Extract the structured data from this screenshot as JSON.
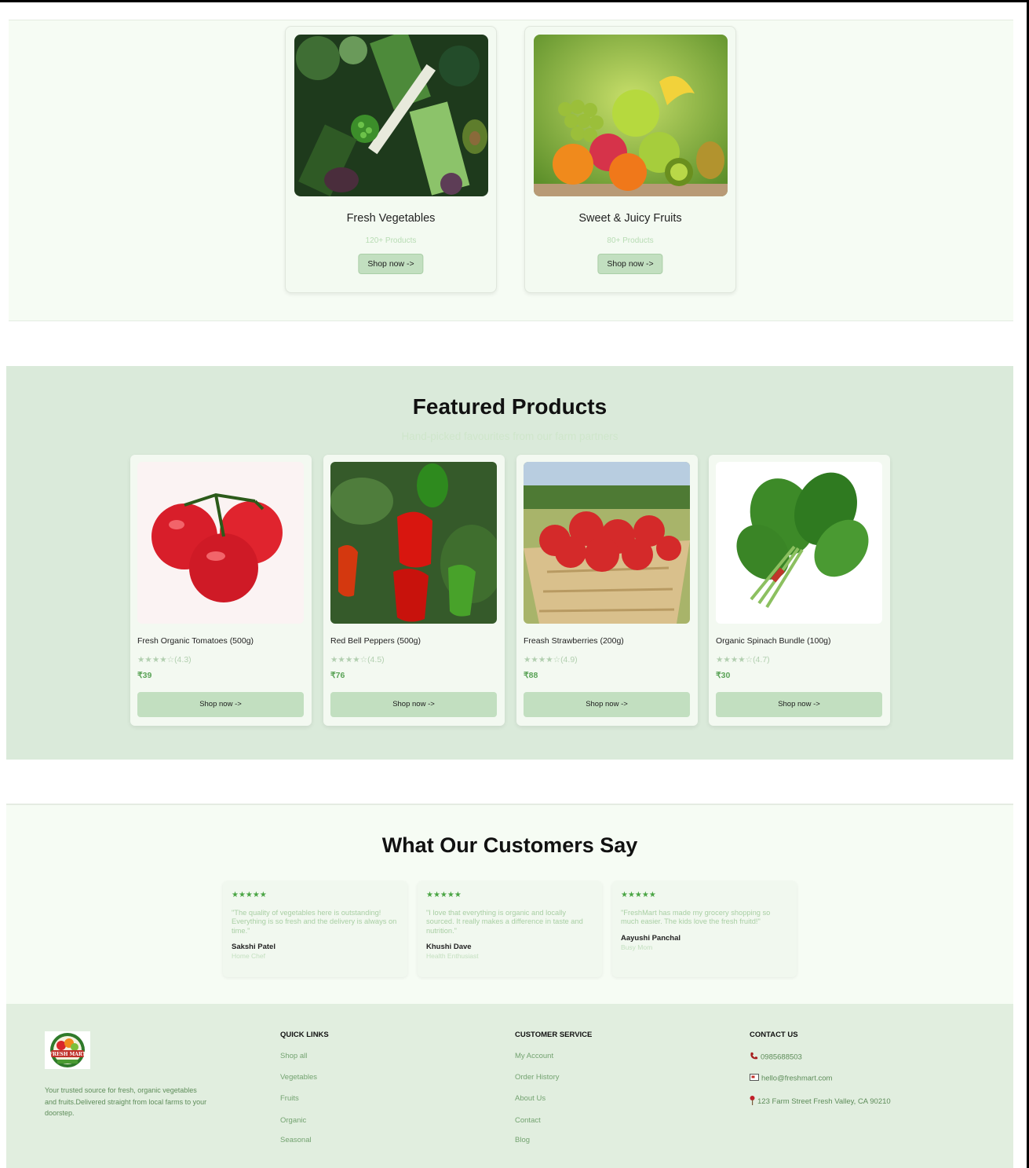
{
  "categories": [
    {
      "title": "Fresh Vegetables",
      "count": "120+ Products",
      "button": "Shop now ->",
      "image_icon": "vegetables-image"
    },
    {
      "title": "Sweet & Juicy Fruits",
      "count": "80+ Products",
      "button": "Shop now ->",
      "image_icon": "fruits-image"
    }
  ],
  "featured": {
    "title": "Featured Products",
    "subtitle": "Hand-picked favourites from our farm partners",
    "products": [
      {
        "name": "Fresh Organic Tomatoes (500g)",
        "rating": "★★★★☆(4.3)",
        "price": "₹39",
        "button": "Shop now ->"
      },
      {
        "name": "Red Bell Peppers (500g)",
        "rating": "★★★★☆(4.5)",
        "price": "₹76",
        "button": "Shop now ->"
      },
      {
        "name": "Freash Strawberries (200g)",
        "rating": "★★★★☆(4.9)",
        "price": "₹88",
        "button": "Shop now ->"
      },
      {
        "name": "Organic Spinach Bundle (100g)",
        "rating": "★★★★☆(4.7)",
        "price": "₹30",
        "button": "Shop now ->"
      }
    ]
  },
  "testimonials": {
    "title": "What Our Customers Say",
    "items": [
      {
        "stars": "★★★★★",
        "quote": "\"The quality of vegetables here is outstanding! Everything is so fresh and the delivery is always on time.\"",
        "name": "Sakshi Patel",
        "role": "Home Chef"
      },
      {
        "stars": "★★★★★",
        "quote": "\"I love that everything is organic and locally sourced. It really makes a difference in taste and nutrition.\"",
        "name": "Khushi Dave",
        "role": "Health Enthusiast"
      },
      {
        "stars": "★★★★★",
        "quote": "\"FreshMart has made my grocery shopping so much easier. The kids love the fresh fruitd!\"",
        "name": "Aayushi Panchal",
        "role": "Busy Mom"
      }
    ]
  },
  "footer": {
    "logo_text": "FRESH MART",
    "description": "Your trusted source for fresh, organic vegetables and fruits.Delivered straight from local farms to your doorstep.",
    "quick_links": {
      "heading": "QUICK LINKS",
      "items": [
        "Shop all",
        "Vegetables",
        "Fruits",
        "Organic",
        "Seasonal"
      ]
    },
    "customer_service": {
      "heading": "CUSTOMER SERVICE",
      "items": [
        "My Account",
        "Order History",
        "About Us",
        "Contact",
        "Blog"
      ]
    },
    "contact": {
      "heading": "CONTACT US",
      "phone": "0985688503",
      "email": "hello@freshmart.com",
      "address": "123 Farm Street Fresh Valley, CA 90210"
    }
  },
  "colors": {
    "accent_green": "#5aa357",
    "button_bg": "#c2dfc0",
    "featured_bg": "#daeada",
    "footer_bg": "#e1eedf"
  }
}
